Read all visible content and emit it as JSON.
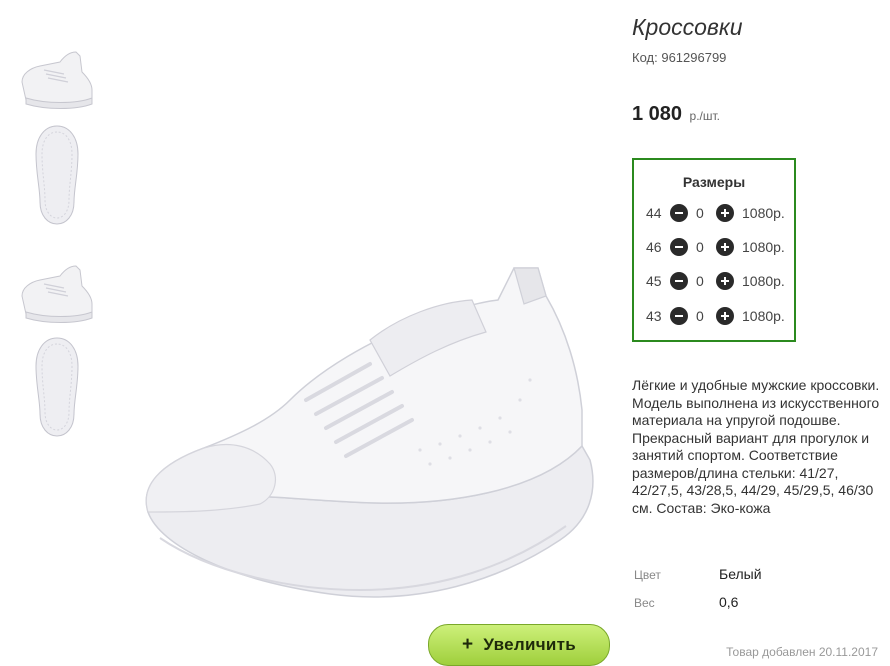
{
  "product": {
    "title": "Кроссовки",
    "code_label": "Код:",
    "code_value": "961296799",
    "price": "1 080",
    "price_unit": "р./шт."
  },
  "sizes": {
    "title": "Размеры",
    "rows": [
      {
        "size": "44",
        "qty": "0",
        "price": "1080р."
      },
      {
        "size": "46",
        "qty": "0",
        "price": "1080р."
      },
      {
        "size": "45",
        "qty": "0",
        "price": "1080р."
      },
      {
        "size": "43",
        "qty": "0",
        "price": "1080р."
      }
    ]
  },
  "description": "Лёгкие и удобные мужские кроссовки. Модель выполнена из искусственного материала на упругой подошве. Прекрасный вариант для прогулок и занятий спортом. Соответствие размеров/длина стельки: 41/27, 42/27,5, 43/28,5, 44/29, 45/29,5, 46/30 см. Состав: Эко-кожа",
  "properties": [
    {
      "key": "Цвет",
      "value": "Белый"
    },
    {
      "key": "Вес",
      "value": "0,6"
    }
  ],
  "zoom_button": {
    "icon": "plus-icon",
    "label": "Увеличить"
  },
  "added_text": "Товар добавлен 20.11.2017",
  "colors": {
    "accent_border": "#2b8a1e",
    "zoom_button": "#b6e35a"
  }
}
